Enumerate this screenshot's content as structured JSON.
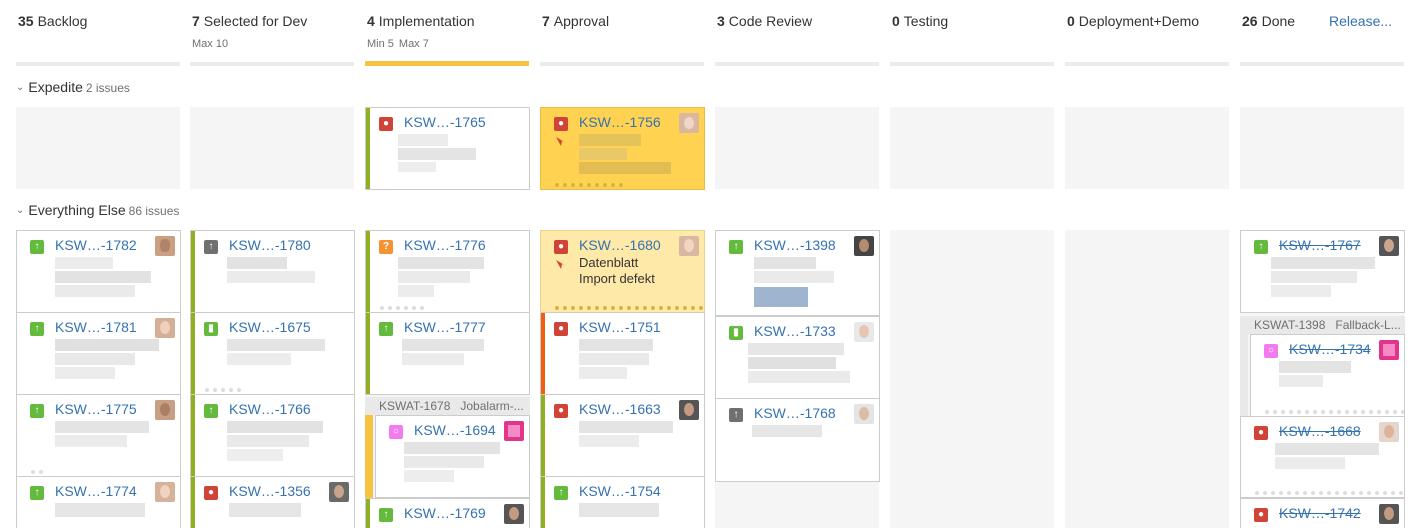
{
  "columns": [
    {
      "count": "35",
      "name": "Backlog",
      "min": "",
      "max": ""
    },
    {
      "count": "7",
      "name": "Selected for Dev",
      "min": "",
      "max": "Max 10"
    },
    {
      "count": "4",
      "name": "Implementation",
      "min": "Min 5",
      "max": "Max 7"
    },
    {
      "count": "7",
      "name": "Approval",
      "min": "",
      "max": ""
    },
    {
      "count": "3",
      "name": "Code Review",
      "min": "",
      "max": ""
    },
    {
      "count": "0",
      "name": "Testing",
      "min": "",
      "max": ""
    },
    {
      "count": "0",
      "name": "Deployment+Demo",
      "min": "",
      "max": ""
    },
    {
      "count": "26",
      "name": "Done",
      "min": "",
      "max": ""
    }
  ],
  "release_link": "Release...",
  "swimlanes": [
    {
      "name": "Expedite",
      "count": "2 issues"
    },
    {
      "name": "Everything Else",
      "count": "86 issues"
    }
  ],
  "cards": {
    "exp_impl_1765": {
      "key": "KSW…-1765",
      "type": "bug-icon"
    },
    "exp_appr_1756": {
      "key": "KSW…-1756",
      "type": "bug-icon"
    },
    "b_1782": {
      "key": "KSW…-1782",
      "type": "story-icon"
    },
    "b_1781": {
      "key": "KSW…-1781",
      "type": "story-icon"
    },
    "b_1775": {
      "key": "KSW…-1775",
      "type": "story-icon"
    },
    "b_1774": {
      "key": "KSW…-1774",
      "type": "story-icon"
    },
    "s_1780": {
      "key": "KSW…-1780",
      "type": "task-icon"
    },
    "s_1675": {
      "key": "KSW…-1675",
      "type": "story-icon"
    },
    "s_1766": {
      "key": "KSW…-1766",
      "type": "story-icon"
    },
    "s_1356": {
      "key": "KSW…-1356",
      "type": "bug-icon"
    },
    "i_1776": {
      "key": "KSW…-1776",
      "type": "question-icon"
    },
    "i_1777": {
      "key": "KSW…-1777",
      "type": "story-icon"
    },
    "i_parent": {
      "key": "KSWAT-1678",
      "summary": "Jobalarm-..."
    },
    "i_1694": {
      "key": "KSW…-1694",
      "type": "subtask-icon"
    },
    "i_1769": {
      "key": "KSW…-1769",
      "type": "story-icon"
    },
    "a_1680": {
      "key": "KSW…-1680",
      "type": "bug-icon",
      "summary_line1": "Datenblatt",
      "summary_line2": "Import defekt"
    },
    "a_1751": {
      "key": "KSW…-1751",
      "type": "bug-icon"
    },
    "a_1663": {
      "key": "KSW…-1663",
      "type": "bug-icon"
    },
    "a_1754": {
      "key": "KSW…-1754",
      "type": "story-icon"
    },
    "c_1398": {
      "key": "KSW…-1398",
      "type": "story-icon"
    },
    "c_1733": {
      "key": "KSW…-1733",
      "type": "story-icon"
    },
    "c_1768": {
      "key": "KSW…-1768",
      "type": "task-icon"
    },
    "d_1767": {
      "key": "KSW…-1767",
      "type": "story-icon"
    },
    "d_parent": {
      "key": "KSWAT-1398",
      "summary": "Fallback-L..."
    },
    "d_1734": {
      "key": "KSW…-1734",
      "type": "subtask-icon"
    },
    "d_1668": {
      "key": "KSW…-1668",
      "type": "bug-icon"
    },
    "d_1742": {
      "key": "KSW…-1742",
      "type": "bug-icon"
    }
  },
  "colors": {
    "link": "#3572b0",
    "story": "#63ba3c",
    "bug": "#d04437",
    "expedite_card": "#ffd351",
    "wip_warning": "#f6c342"
  }
}
